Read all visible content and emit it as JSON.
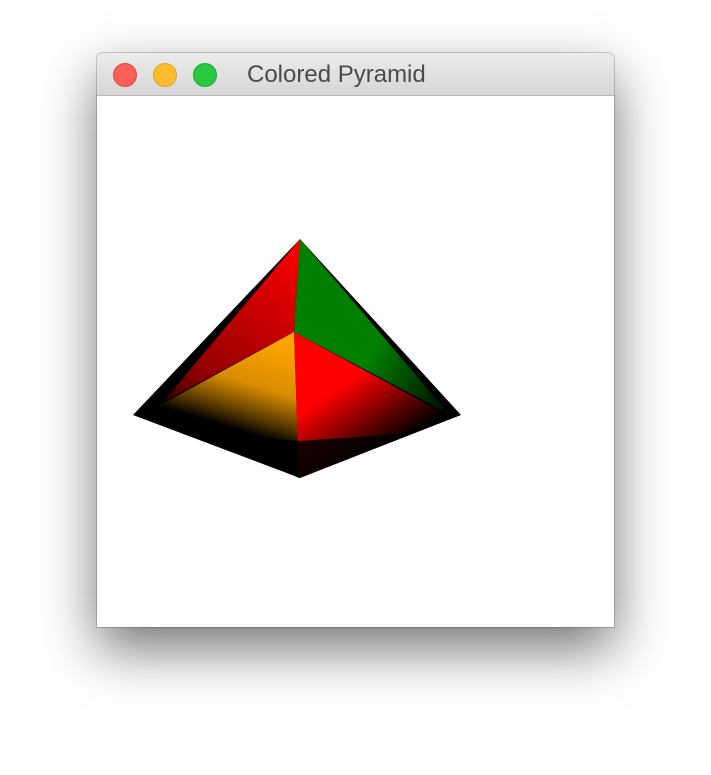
{
  "window": {
    "title": "Colored Pyramid"
  },
  "traffic_lights": {
    "close_color": "#fe5f57",
    "close_border": "#e0443e",
    "minimize_color": "#febc2e",
    "minimize_border": "#dea123",
    "zoom_color": "#28c840",
    "zoom_border": "#1aab29"
  },
  "pyramid": {
    "background": "#ffffff",
    "base_color": "#000000",
    "face_colors": {
      "front": "#ffa500",
      "right": "#ff0000",
      "back_left": "#ff0000",
      "back_right": "#008000"
    }
  }
}
